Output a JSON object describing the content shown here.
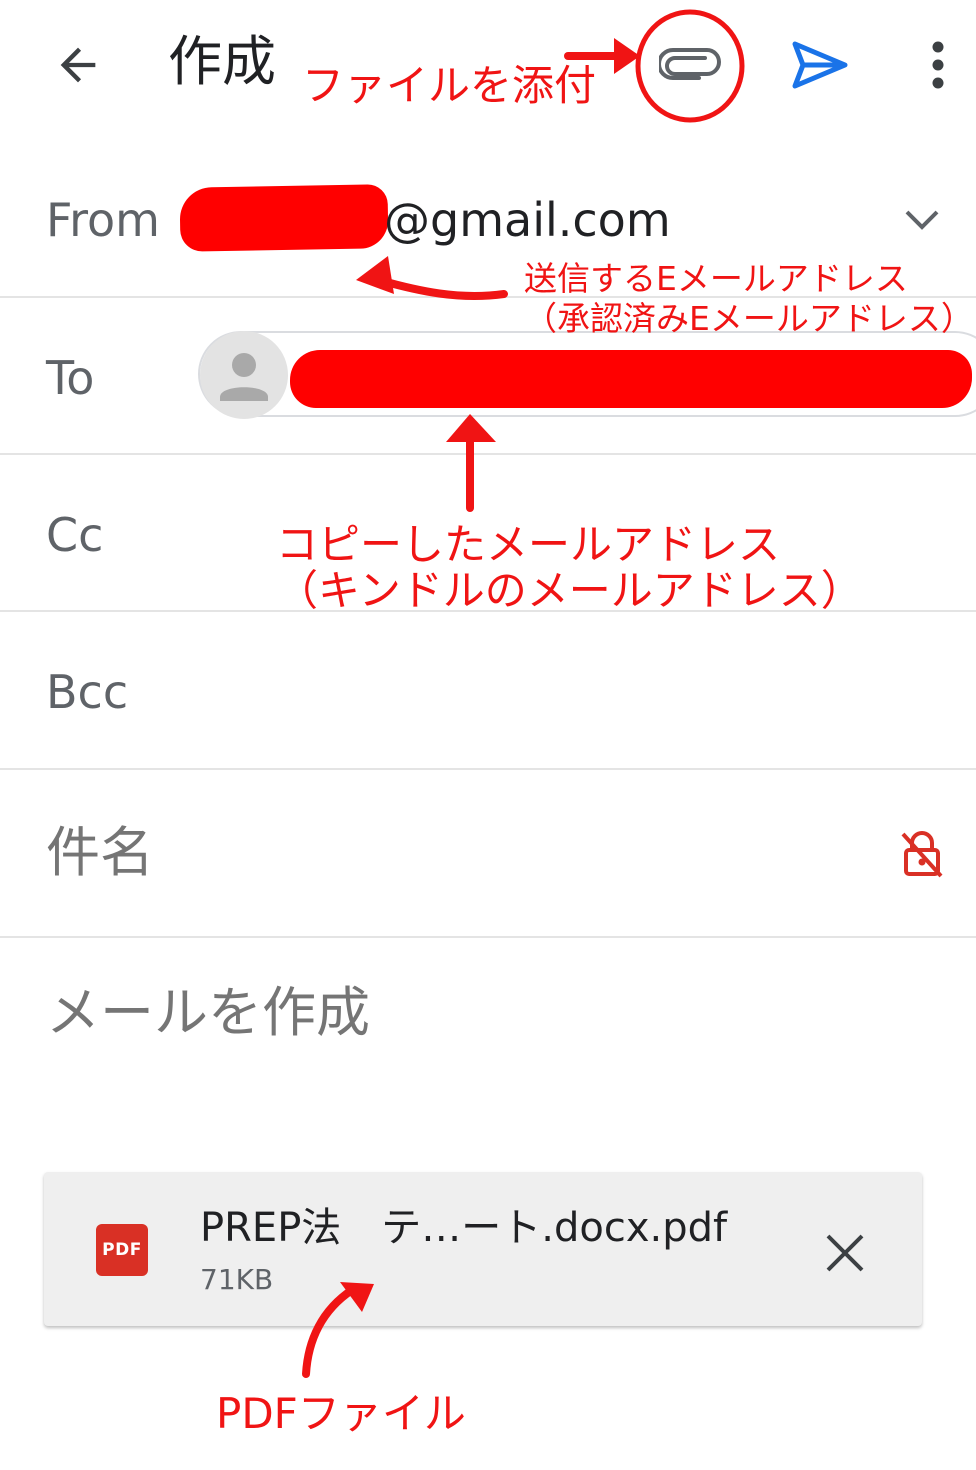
{
  "toolbar": {
    "title": "作成",
    "back_icon": "arrow-back-icon",
    "attach_icon": "paperclip-icon",
    "send_icon": "send-icon",
    "more_icon": "more-vert-icon",
    "send_color": "#1a73e8"
  },
  "from": {
    "label": "From",
    "value_suffix": "@gmail.com",
    "expand_icon": "chevron-down-icon"
  },
  "to": {
    "label": "To",
    "avatar_icon": "person-icon"
  },
  "cc": {
    "label": "Cc"
  },
  "bcc": {
    "label": "Bcc"
  },
  "subject": {
    "placeholder": "件名",
    "confidential_icon": "lock-off-icon"
  },
  "body": {
    "placeholder": "メールを作成"
  },
  "attachment": {
    "type_badge": "PDF",
    "file_name": "PREP法　テ…ート.docx.pdf",
    "file_size": "71KB",
    "remove_icon": "close-icon"
  },
  "annotations": {
    "attach": "ファイルを添付",
    "from_line1": "送信するEメールアドレス",
    "from_line2": "（承認済みEメールアドレス）",
    "to_line1": "コピーしたメールアドレス",
    "to_line2": "（キンドルのメールアドレス）",
    "pdf": "PDFファイル",
    "color": "#f01414"
  },
  "colors": {
    "accent": "#1a73e8",
    "annotation": "#f01414",
    "pdf_badge": "#d93025"
  }
}
